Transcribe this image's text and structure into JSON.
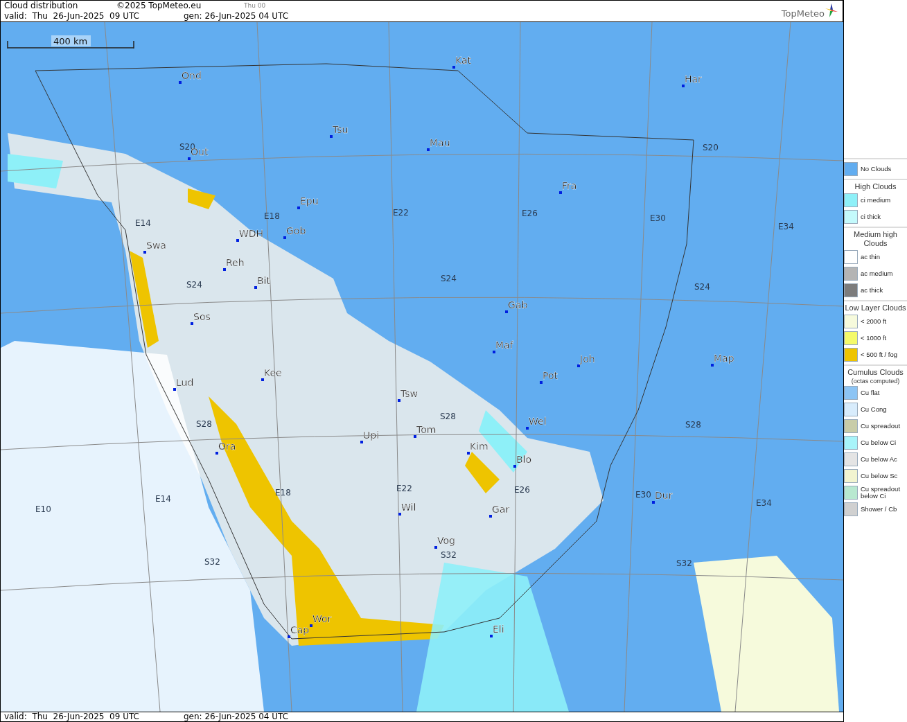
{
  "header": {
    "title": "Cloud distribution",
    "copyright": "©2025 TopMeteo.eu",
    "run": "Thu 00",
    "valid": "valid:  Thu  26-Jun-2025  09 UTC",
    "generated": "gen: 26-Jun-2025 04 UTC",
    "logo": "TopMeteo"
  },
  "map": {
    "scale": "400 km",
    "cities": [
      "Ond",
      "Kat",
      "Har",
      "Tsu",
      "Mau",
      "Out",
      "Fra",
      "Epu",
      "WDH",
      "Gob",
      "Swa",
      "Reh",
      "Bit",
      "Gab",
      "Sos",
      "Maf",
      "Joh",
      "Map",
      "Kee",
      "Pot",
      "Lud",
      "Tsw",
      "Wel",
      "Tom",
      "Upi",
      "Kim",
      "Ora",
      "Blo",
      "Dur",
      "Wil",
      "Gar",
      "Vog",
      "Wor",
      "Cap",
      "Eli"
    ],
    "grid_labels": [
      "S20",
      "S20",
      "E18",
      "E14",
      "E22",
      "E26",
      "E30",
      "E34",
      "S24",
      "S24",
      "S24",
      "S28",
      "S28",
      "S28",
      "E18",
      "E22",
      "E26",
      "E30",
      "E34",
      "E14",
      "E10",
      "S32",
      "S32",
      "S32"
    ]
  },
  "legend": [
    {
      "items": [
        {
          "label": "No Clouds",
          "color": "#62adf0"
        }
      ]
    },
    {
      "heading": "High Clouds",
      "items": [
        {
          "label": "ci medium",
          "color": "#8ef0f8"
        },
        {
          "label": "ci thick",
          "color": "#c4fafc"
        }
      ]
    },
    {
      "heading": "Medium high Clouds",
      "items": [
        {
          "label": "ac thin",
          "color": "#ffffff"
        },
        {
          "label": "ac medium",
          "color": "#b4b4b4"
        },
        {
          "label": "ac thick",
          "color": "#7c7c7c"
        }
      ]
    },
    {
      "heading": "Low Layer Clouds",
      "items": [
        {
          "label": "< 2000 ft",
          "color": "#f6fadc"
        },
        {
          "label": "< 1000 ft",
          "color": "#f4fa6a"
        },
        {
          "label": "< 500 ft / fog",
          "color": "#eec400"
        }
      ]
    },
    {
      "heading": "Cumulus Clouds",
      "subheading": "(octas computed)",
      "items": [
        {
          "label": "Cu flat",
          "color": "#8cc4f4"
        },
        {
          "label": "Cu Cong",
          "color": "#d8ecfc"
        },
        {
          "label": "Cu spreadout",
          "color": "#c8cca8"
        },
        {
          "label": "Cu below Ci",
          "color": "#a8f4fa"
        },
        {
          "label": "Cu below Ac",
          "color": "#e4e4e4"
        },
        {
          "label": "Cu below Sc",
          "color": "#f2f4d0"
        },
        {
          "label": "Cu spreadout below Ci",
          "color": "#b8e8d0"
        },
        {
          "label": "Shower / Cb",
          "color": "#d0d0d0"
        }
      ]
    }
  ],
  "footer": {
    "valid": "valid:  Thu  26-Jun-2025  09 UTC",
    "generated": "gen: 26-Jun-2025 04 UTC"
  }
}
